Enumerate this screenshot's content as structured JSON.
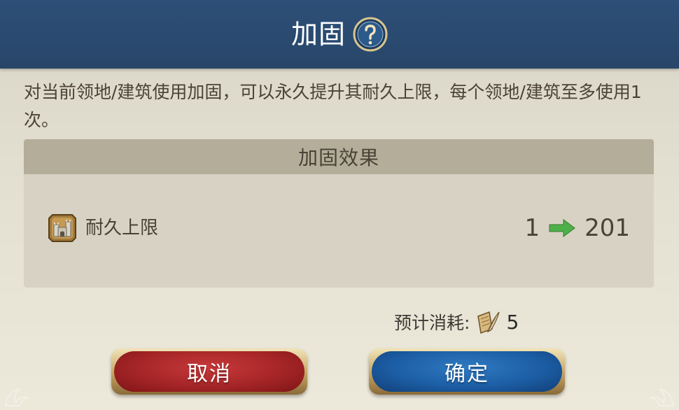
{
  "dialog": {
    "title": "加固",
    "description": "对当前领地/建筑使用加固，可以永久提升其耐久上限，每个领地/建筑至多使用1次。",
    "help_icon": "question-mark-icon"
  },
  "effect": {
    "title": "加固效果",
    "stat": {
      "icon": "fortress-wall-icon",
      "label": "耐久上限",
      "from": "1",
      "to": "201",
      "arrow_icon": "right-arrow-icon",
      "arrow_color": "#4fb04a"
    }
  },
  "cost": {
    "label": "预计消耗:",
    "icon": "scroll-quill-icon",
    "value": "5"
  },
  "buttons": {
    "cancel_label": "取消",
    "confirm_label": "确定"
  },
  "colors": {
    "header": "#2b4a71",
    "cancel": "#a52527",
    "confirm": "#1c5ea5",
    "text": "#4a4236"
  }
}
